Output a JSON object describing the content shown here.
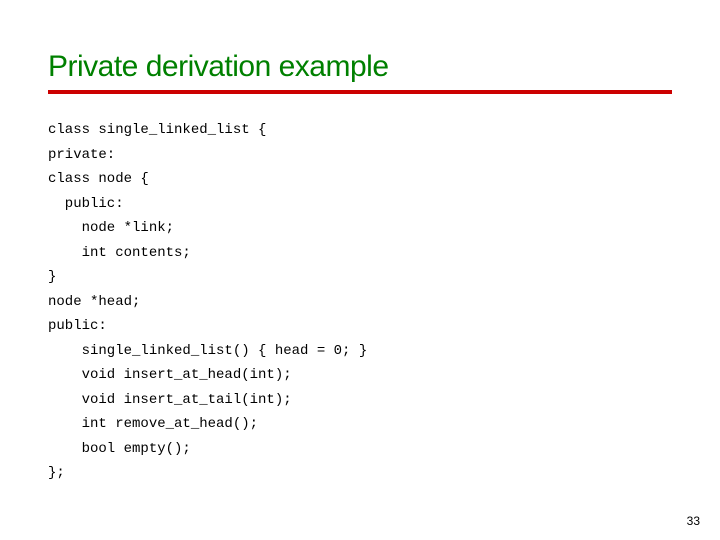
{
  "slide": {
    "title": "Private derivation example",
    "page_number": "33"
  },
  "code": {
    "l01": "class single_linked_list {",
    "l02": "private:",
    "l03": "class node {",
    "l04": "  public:",
    "l05": "    node *link;",
    "l06": "    int contents;",
    "l07": "}",
    "l08": "node *head;",
    "l09": "public:",
    "l10": "    single_linked_list() { head = 0; }",
    "l11": "    void insert_at_head(int);",
    "l12": "    void insert_at_tail(int);",
    "l13": "    int remove_at_head();",
    "l14": "    bool empty();",
    "l15": "};"
  }
}
